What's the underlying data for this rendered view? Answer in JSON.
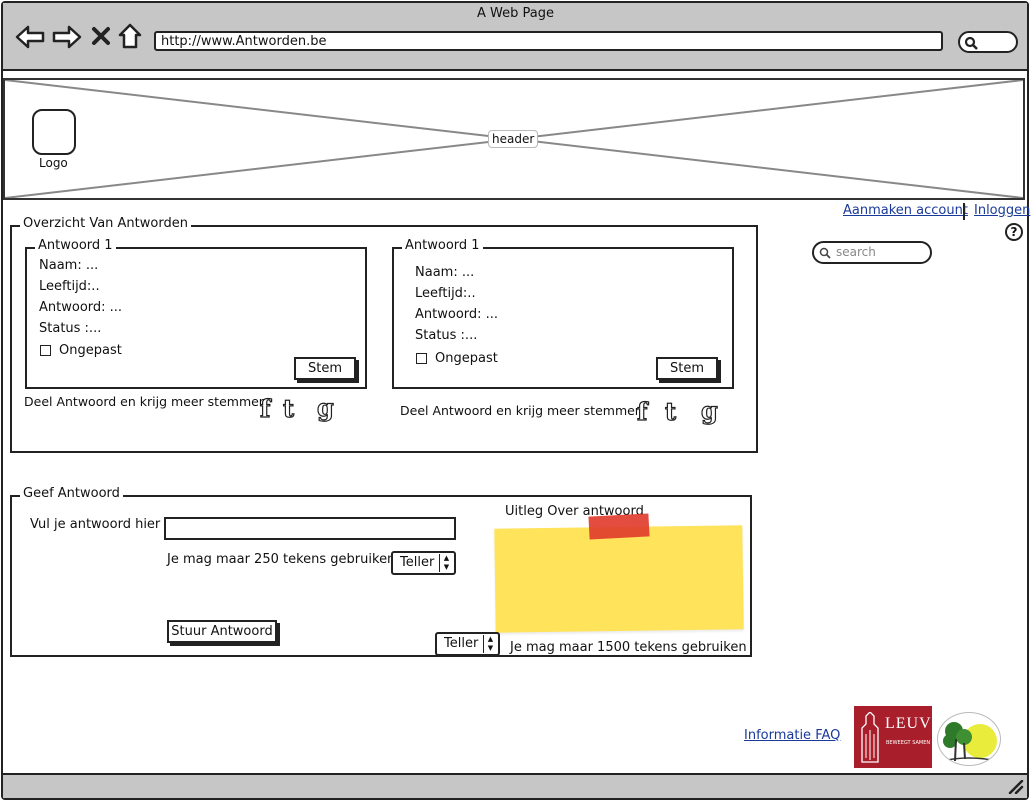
{
  "browser": {
    "window_title": "A Web Page",
    "url": "http://www.Antworden.be"
  },
  "header": {
    "label": "header",
    "logo_label": "Logo"
  },
  "account_links": {
    "create": "Aanmaken account",
    "login": "Inloggen"
  },
  "search": {
    "placeholder": "search"
  },
  "overview": {
    "title": "Overzicht Van Antworden",
    "answers": [
      {
        "title": "Antwoord 1",
        "name": "Naam: ...",
        "age": "Leeftijd:..",
        "answer": "Antwoord: ...",
        "status": "Status :...",
        "checkbox_label": "Ongepast",
        "vote_button": "Stem",
        "share_text": "Deel Antwoord en krijg meer stemmen"
      },
      {
        "title": "Antwoord 1",
        "name": "Naam: ...",
        "age": "Leeftijd:..",
        "answer": "Antwoord: ...",
        "status": "Status :...",
        "checkbox_label": "Ongepast",
        "vote_button": "Stem",
        "share_text": "Deel Antwoord en krijg meer stemmen"
      }
    ],
    "social_icons": [
      "facebook-icon",
      "twitter-icon",
      "google-icon"
    ]
  },
  "give_answer": {
    "title": "Geef Antwoord",
    "input_label": "Vul je antwoord hier",
    "limit_short": "Je mag maar 250 tekens gebruiken",
    "counter_label": "Teller",
    "submit_button": "Stuur Antwoord",
    "note_title": "Uitleg Over antwoord",
    "limit_long": "Je mag maar 1500 tekens gebruiken",
    "counter_label_2": "Teller"
  },
  "footer": {
    "faq_link": "Informatie FAQ",
    "logo_text": "LEUVEN",
    "logo_subtext": "BEWEEGT SAMEN"
  },
  "colors": {
    "chrome": "#c6c6c6",
    "link": "#1a3a9a",
    "note": "#ffe35a",
    "tape": "#e03a2b",
    "leuven_red": "#a81e2a"
  }
}
